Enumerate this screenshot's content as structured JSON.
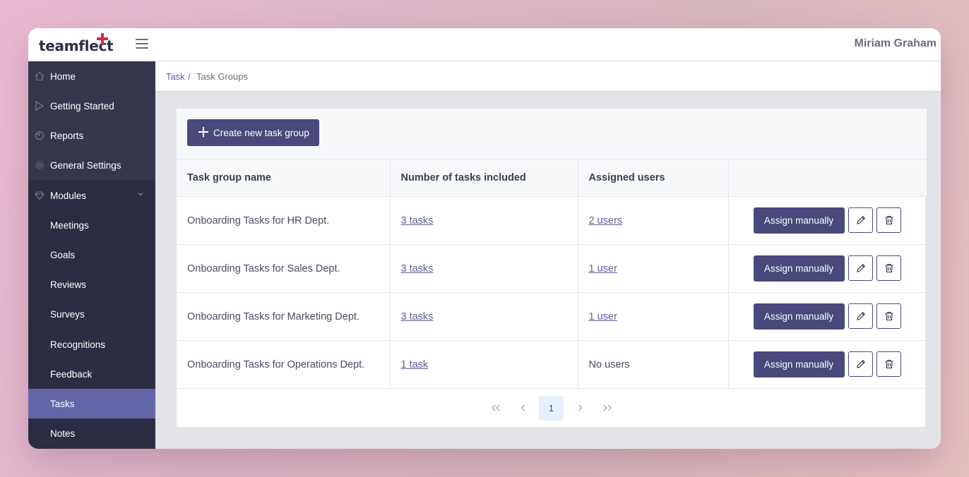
{
  "app": {
    "logo": "teamflect",
    "user_name": "Miriam Graham"
  },
  "sidebar": {
    "items": [
      {
        "label": "Home",
        "icon": "home-icon"
      },
      {
        "label": "Getting Started",
        "icon": "play-icon"
      },
      {
        "label": "Reports",
        "icon": "pie-chart-icon"
      },
      {
        "label": "General Settings",
        "icon": "gear-icon"
      },
      {
        "label": "Modules",
        "icon": "diamond-icon"
      },
      {
        "label": "Meetings"
      },
      {
        "label": "Goals"
      },
      {
        "label": "Reviews"
      },
      {
        "label": "Surveys"
      },
      {
        "label": "Recognitions"
      },
      {
        "label": "Feedback"
      },
      {
        "label": "Tasks"
      },
      {
        "label": "Notes"
      }
    ],
    "active": "Tasks"
  },
  "breadcrumb": {
    "parent": "Task",
    "separator": "/",
    "current": "Task Groups"
  },
  "toolbar": {
    "create_label": "Create new task group"
  },
  "table": {
    "headers": [
      "Task group name",
      "Number of tasks included",
      "Assigned users",
      ""
    ],
    "rows": [
      {
        "name": "Onboarding Tasks for HR Dept.",
        "tasks": "3 tasks",
        "users": "2 users",
        "users_link": true
      },
      {
        "name": "Onboarding Tasks for Sales Dept.",
        "tasks": "3 tasks",
        "users": "1 user",
        "users_link": true
      },
      {
        "name": "Onboarding Tasks for Marketing Dept.",
        "tasks": "3 tasks",
        "users": "1 user",
        "users_link": true
      },
      {
        "name": "Onboarding Tasks for Operations Dept.",
        "tasks": "1 task",
        "users": "No users",
        "users_link": false
      }
    ],
    "assign_label": "Assign manually"
  },
  "pagination": {
    "first": "«",
    "prev": "‹",
    "current": "1",
    "next": "›",
    "last": "»"
  },
  "colors": {
    "sidebar_bg": "#2b2d42",
    "sidebar_active": "#6266a7",
    "primary_button": "#474a7a",
    "link": "#5c5f9e",
    "logo_accent": "#d62b4b"
  }
}
